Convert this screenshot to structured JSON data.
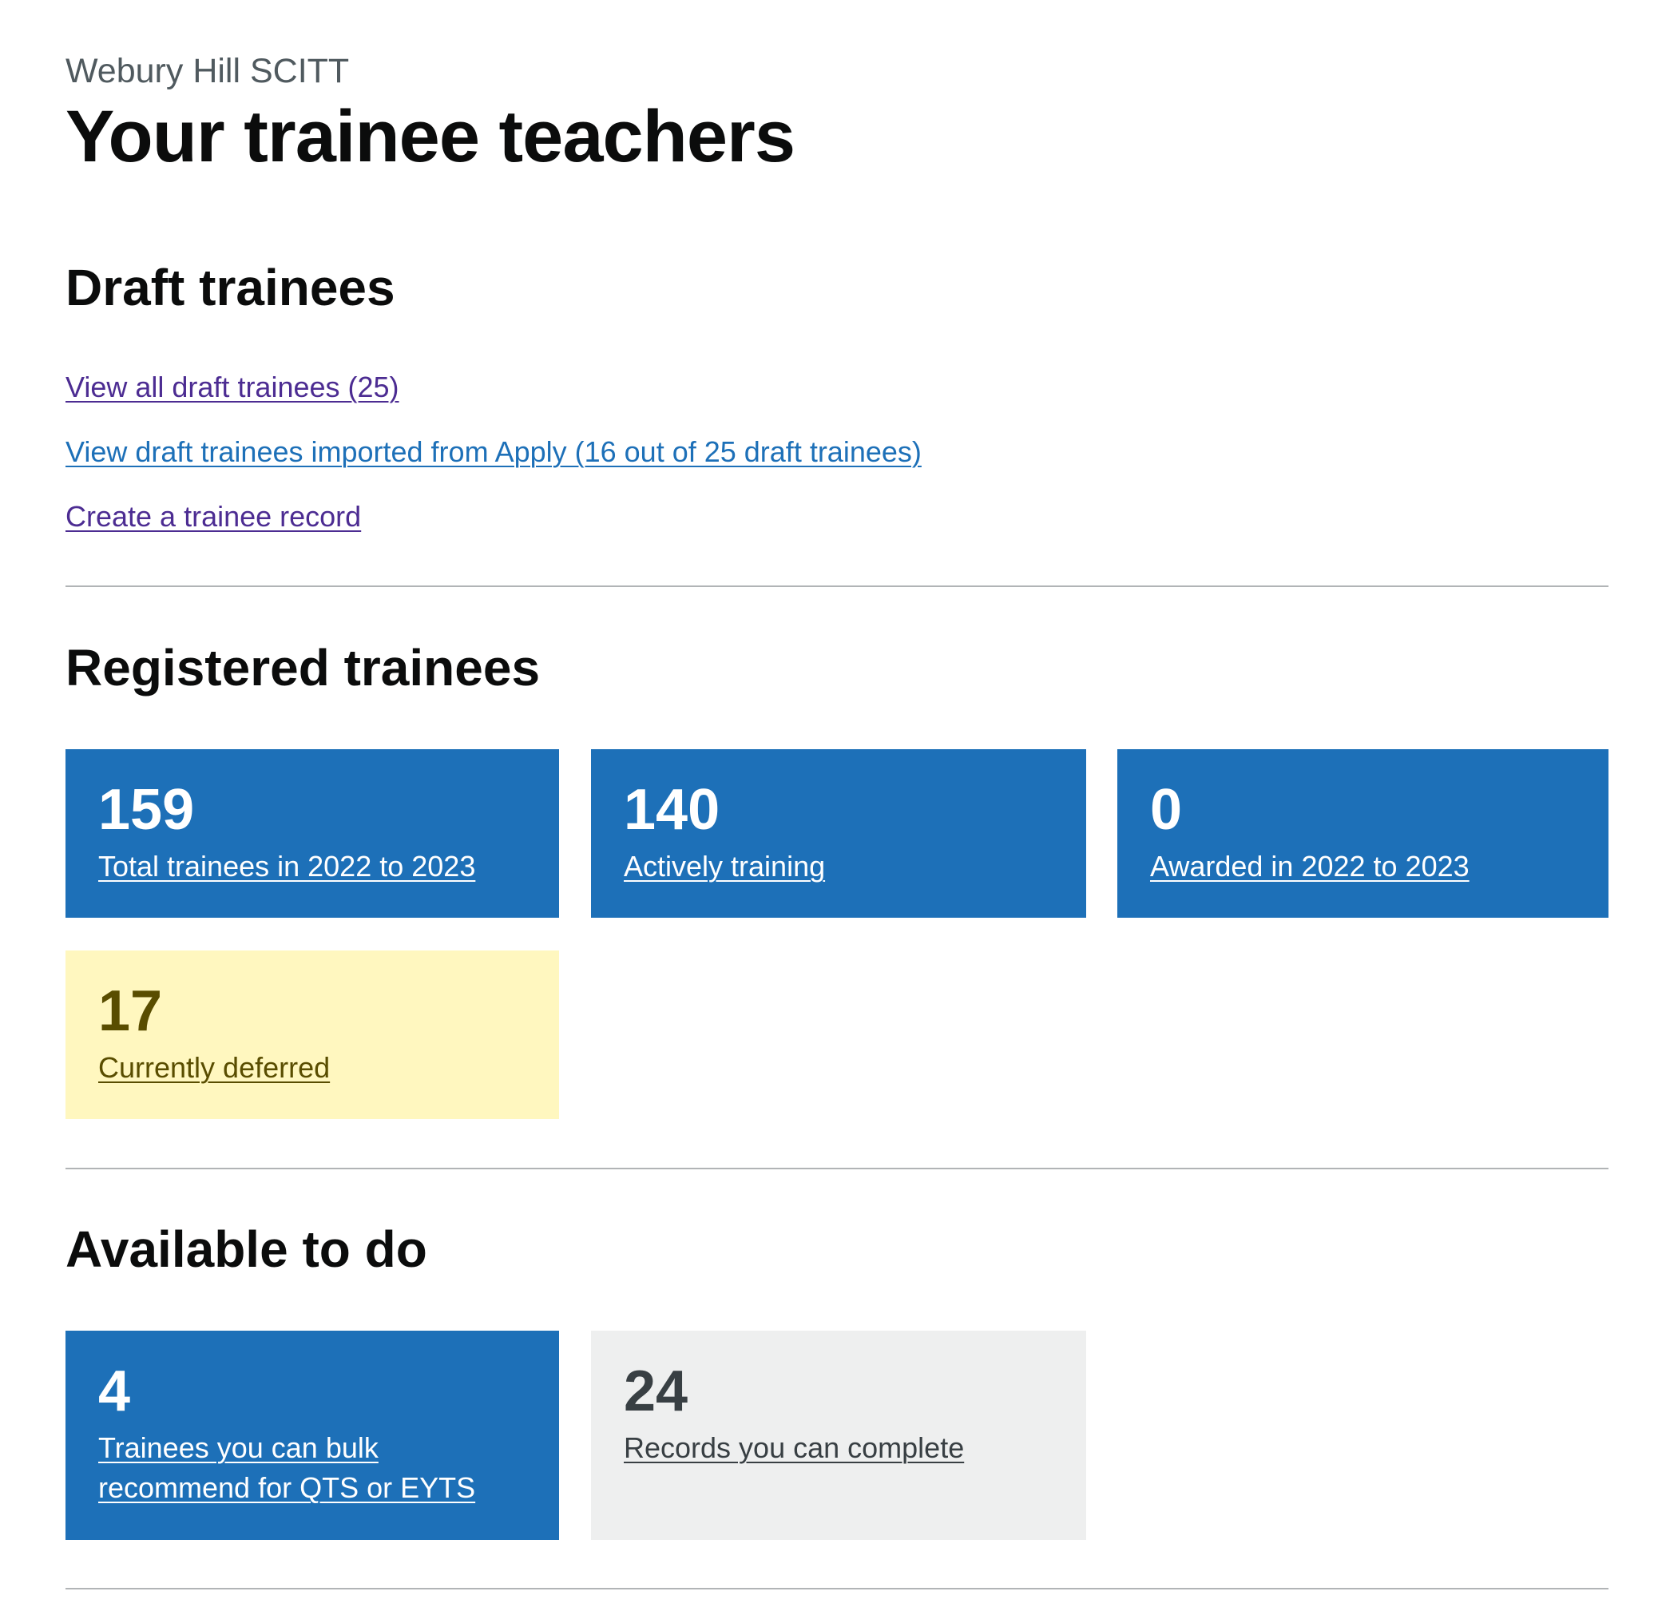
{
  "header": {
    "caption": "Webury Hill SCITT",
    "title": "Your trainee teachers"
  },
  "draft": {
    "heading": "Draft trainees",
    "links": {
      "view_all": "View all draft trainees (25)",
      "view_apply": "View draft trainees imported from Apply (16 out of 25 draft trainees)",
      "create": "Create a trainee record"
    }
  },
  "registered": {
    "heading": "Registered trainees",
    "cards": {
      "total": {
        "count": "159",
        "label": "Total trainees in 2022 to 2023"
      },
      "active": {
        "count": "140",
        "label": "Actively training"
      },
      "awarded": {
        "count": "0",
        "label": "Awarded in 2022 to 2023"
      },
      "deferred": {
        "count": "17",
        "label": "Currently deferred"
      }
    }
  },
  "available": {
    "heading": "Available to do",
    "cards": {
      "bulk": {
        "count": "4",
        "label": "Trainees you can bulk recommend for QTS or EYTS"
      },
      "complete": {
        "count": "24",
        "label": "Records you can complete"
      }
    }
  },
  "colors": {
    "blue": "#1d70b8",
    "yellow": "#fff7bf",
    "yellow_text": "#594d00",
    "grey": "#eeefef",
    "visited_link": "#4c2c92",
    "link": "#1d70b8"
  }
}
